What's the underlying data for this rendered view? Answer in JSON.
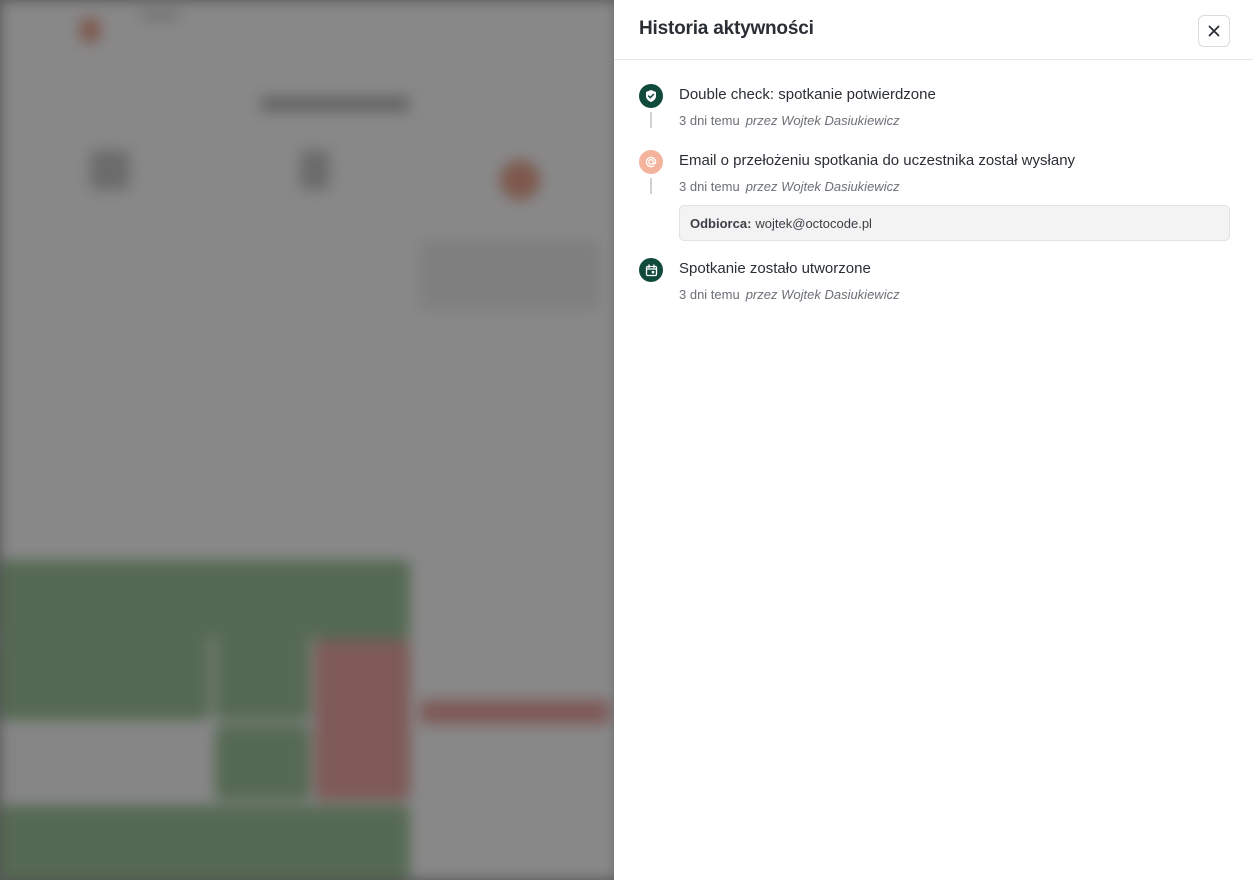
{
  "drawer": {
    "title": "Historia aktywności",
    "close_icon": "close-icon"
  },
  "events": [
    {
      "icon": "shield-check-icon",
      "icon_color": "#0f4a3a",
      "title": "Double check: spotkanie potwierdzone",
      "time": "3 dni temu",
      "author": "przez Wojtek Dasiukiewicz"
    },
    {
      "icon": "at-sign-icon",
      "icon_color": "#f4b39c",
      "title": "Email o przełożeniu spotkania do uczestnika został wysłany",
      "time": "3 dni temu",
      "author": "przez Wojtek Dasiukiewicz",
      "detail_label": "Odbiorca:",
      "detail_value": "wojtek@octocode.pl"
    },
    {
      "icon": "calendar-icon",
      "icon_color": "#0f4a3a",
      "title": "Spotkanie zostało utworzone",
      "time": "3 dni temu",
      "author": "przez Wojtek Dasiukiewicz"
    }
  ]
}
